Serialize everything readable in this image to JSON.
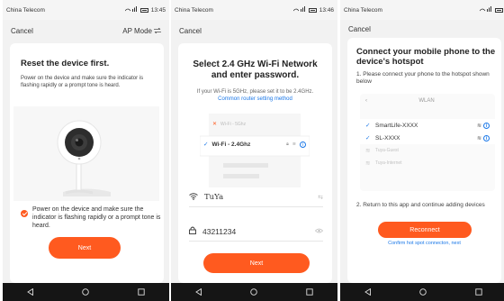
{
  "colors": {
    "accent": "#ff5a1f",
    "link": "#1b78e8"
  },
  "panel1": {
    "status": {
      "carrier": "China Telecom",
      "time": "13:45"
    },
    "topbar": {
      "cancel": "Cancel",
      "mode": "AP Mode"
    },
    "title": "Reset the device first.",
    "desc": "Power on the device and make sure the indicator is flashing rapidly or a prompt tone is heard.",
    "confirm": "Power on the device and make sure the indicator is flashing rapidly or a prompt tone is heard.",
    "next": "Next"
  },
  "panel2": {
    "status": {
      "carrier": "China Telecom",
      "time": "13:46"
    },
    "topbar": {
      "cancel": "Cancel"
    },
    "title": "Select 2.4 GHz Wi-Fi Network and enter password.",
    "note": "If your Wi-Fi is 5GHz, please set it to be 2.4GHz.",
    "note_link": "Common router setting method",
    "wifi_illustration": {
      "bad": "Wi-Fi - 5Ghz",
      "good": "Wi-Fi - 2.4Ghz"
    },
    "ssid": "TuYa",
    "password": "43211234",
    "next": "Next"
  },
  "panel3": {
    "status": {
      "carrier": "China Telecom"
    },
    "topbar": {
      "cancel": "Cancel"
    },
    "title": "Connect your mobile phone to the device's hotspot",
    "step1": "1. Please connect your phone to the hotspot shown below",
    "wlan": {
      "title": "WLAN",
      "networks": [
        {
          "name": "SmartLife-XXXX",
          "active": true
        },
        {
          "name": "SL-XXXX",
          "active": true
        },
        {
          "name": "Tuya-Guest",
          "active": false
        },
        {
          "name": "Tuya-Internet",
          "active": false
        }
      ]
    },
    "step2": "2. Return to this app and continue adding devices",
    "reconnect": "Reconnect",
    "confirm_link": "Confirm hot spot connecton, next"
  }
}
